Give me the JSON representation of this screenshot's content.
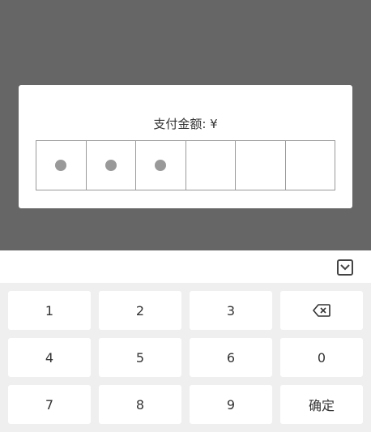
{
  "dialog": {
    "amount_label": "支付金额: ¥",
    "pin_length": 6,
    "pin_entered": 3
  },
  "keyboard": {
    "collapse_icon": "chevron-down-icon",
    "keys": [
      "1",
      "2",
      "3",
      "backspace",
      "4",
      "5",
      "6",
      "0",
      "7",
      "8",
      "9",
      "确定"
    ],
    "backspace_icon": "backspace-icon"
  },
  "colors": {
    "overlay": "#666666",
    "keyboard_bg": "#efefef",
    "pin_dot": "#999999"
  }
}
